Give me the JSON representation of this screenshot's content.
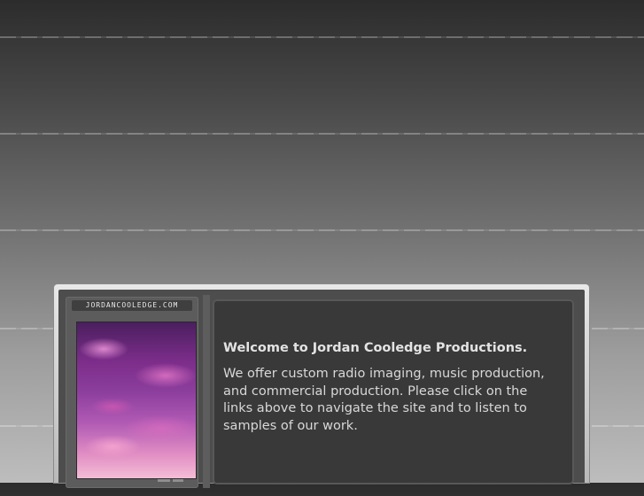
{
  "site": {
    "logo_text": "JORDANCOOLEDGE.COM"
  },
  "content": {
    "title": "Welcome to Jordan Cooledge Productions.",
    "body": "We offer custom radio imaging, music production, and commercial production. Please click on the links above to navigate the site and to listen to samples of our work."
  },
  "photo": {
    "subject": "pink-purple sunset sky clouds"
  },
  "colors": {
    "panel_bg": "#383938",
    "text": "#e3e3e3",
    "frame": "#4c4d4c"
  }
}
